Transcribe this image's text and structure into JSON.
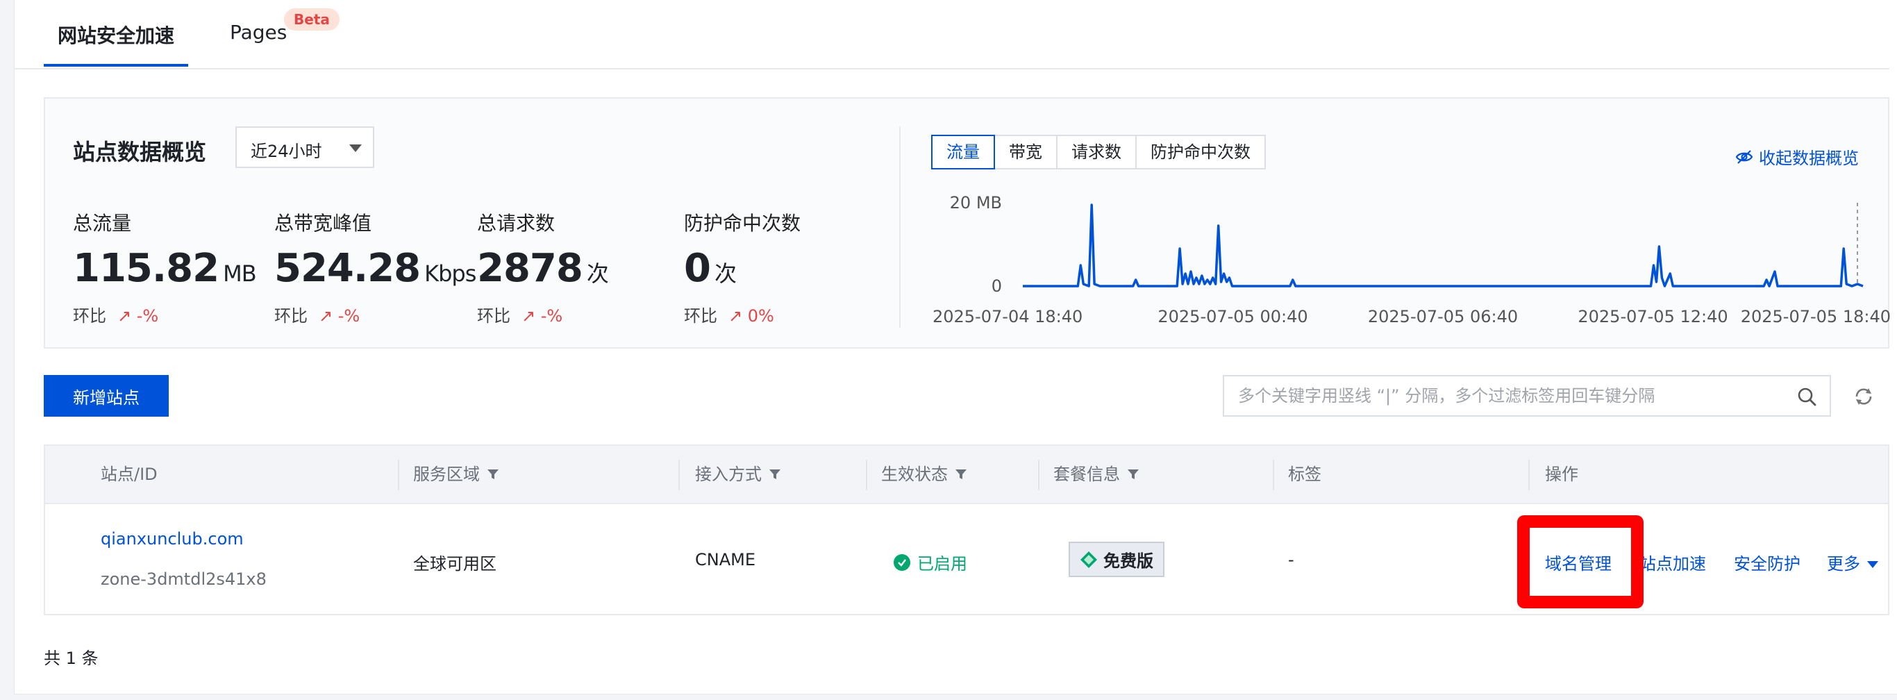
{
  "tabs": {
    "site_accel": "网站安全加速",
    "pages": "Pages",
    "beta": "Beta"
  },
  "overview": {
    "title": "站点数据概览",
    "range": "近24小时",
    "collapse": "收起数据概览",
    "metric_tabs": [
      "流量",
      "带宽",
      "请求数",
      "防护命中次数"
    ],
    "stats": [
      {
        "label": "总流量",
        "value": "115.82",
        "unit": "MB",
        "cmp_label": "环比",
        "cmp_value": "↗ -%"
      },
      {
        "label": "总带宽峰值",
        "value": "524.28",
        "unit": "Kbps",
        "cmp_label": "环比",
        "cmp_value": "↗ -%"
      },
      {
        "label": "总请求数",
        "value": "2878",
        "unit": "次",
        "cmp_label": "环比",
        "cmp_value": "↗ -%"
      },
      {
        "label": "防护命中次数",
        "value": "0",
        "unit": "次",
        "cmp_label": "环比",
        "cmp_value": "↗ 0%"
      }
    ]
  },
  "chart_data": {
    "type": "line",
    "y_tick_labels": [
      "20 MB",
      "0"
    ],
    "x_tick_labels": [
      "2025-07-04 18:40",
      "2025-07-05 00:40",
      "2025-07-05 06:40",
      "2025-07-05 12:40",
      "2025-07-05 18:40"
    ],
    "ylim": [
      0,
      20
    ],
    "y_unit": "MB",
    "series_color": "#0052d9",
    "points": [
      [
        0,
        0
      ],
      [
        20,
        0
      ],
      [
        21,
        5
      ],
      [
        22,
        0.5
      ],
      [
        24,
        0
      ],
      [
        25,
        19.5
      ],
      [
        26,
        0.5
      ],
      [
        28,
        0
      ],
      [
        40,
        0
      ],
      [
        41,
        1.5
      ],
      [
        42,
        0
      ],
      [
        56,
        0
      ],
      [
        57,
        9
      ],
      [
        58,
        0.5
      ],
      [
        59,
        3
      ],
      [
        60,
        0.5
      ],
      [
        61,
        3.5
      ],
      [
        62,
        0.5
      ],
      [
        63,
        2
      ],
      [
        64,
        0.5
      ],
      [
        65,
        2.5
      ],
      [
        66,
        0.5
      ],
      [
        67,
        1.5
      ],
      [
        68,
        0.5
      ],
      [
        69,
        2
      ],
      [
        70,
        0.5
      ],
      [
        71,
        14.5
      ],
      [
        72,
        1
      ],
      [
        73,
        3
      ],
      [
        74,
        1
      ],
      [
        75,
        2
      ],
      [
        76,
        0
      ],
      [
        97,
        0
      ],
      [
        98,
        1.5
      ],
      [
        99,
        0
      ],
      [
        228,
        0
      ],
      [
        229,
        5
      ],
      [
        230,
        1
      ],
      [
        231,
        9.5
      ],
      [
        232,
        2
      ],
      [
        233,
        0
      ],
      [
        235,
        3
      ],
      [
        236,
        0
      ],
      [
        269,
        0
      ],
      [
        270,
        1.5
      ],
      [
        271,
        0
      ],
      [
        273,
        3.5
      ],
      [
        274,
        0
      ],
      [
        297,
        0
      ],
      [
        298,
        9
      ],
      [
        299,
        0.5
      ],
      [
        301,
        0
      ],
      [
        303,
        0.5
      ],
      [
        305,
        0
      ]
    ],
    "x_count": 306
  },
  "toolbar": {
    "add_site": "新增站点",
    "search_placeholder": "多个关键字用竖线 “|” 分隔，多个过滤标签用回车键分隔"
  },
  "table": {
    "headers": {
      "site": "站点/ID",
      "region": "服务区域",
      "access": "接入方式",
      "status": "生效状态",
      "plan": "套餐信息",
      "tags": "标签",
      "ops": "操作"
    },
    "rows": [
      {
        "domain": "qianxunclub.com",
        "zone_id": "zone-3dmtdl2s41x8",
        "region": "全球可用区",
        "access": "CNAME",
        "status": "已启用",
        "plan": "免费版",
        "tags": "-",
        "ops": {
          "domain_mgmt": "域名管理",
          "site_accel": "站点加速",
          "security": "安全防护",
          "more": "更多"
        }
      }
    ],
    "total": "共 1 条"
  }
}
